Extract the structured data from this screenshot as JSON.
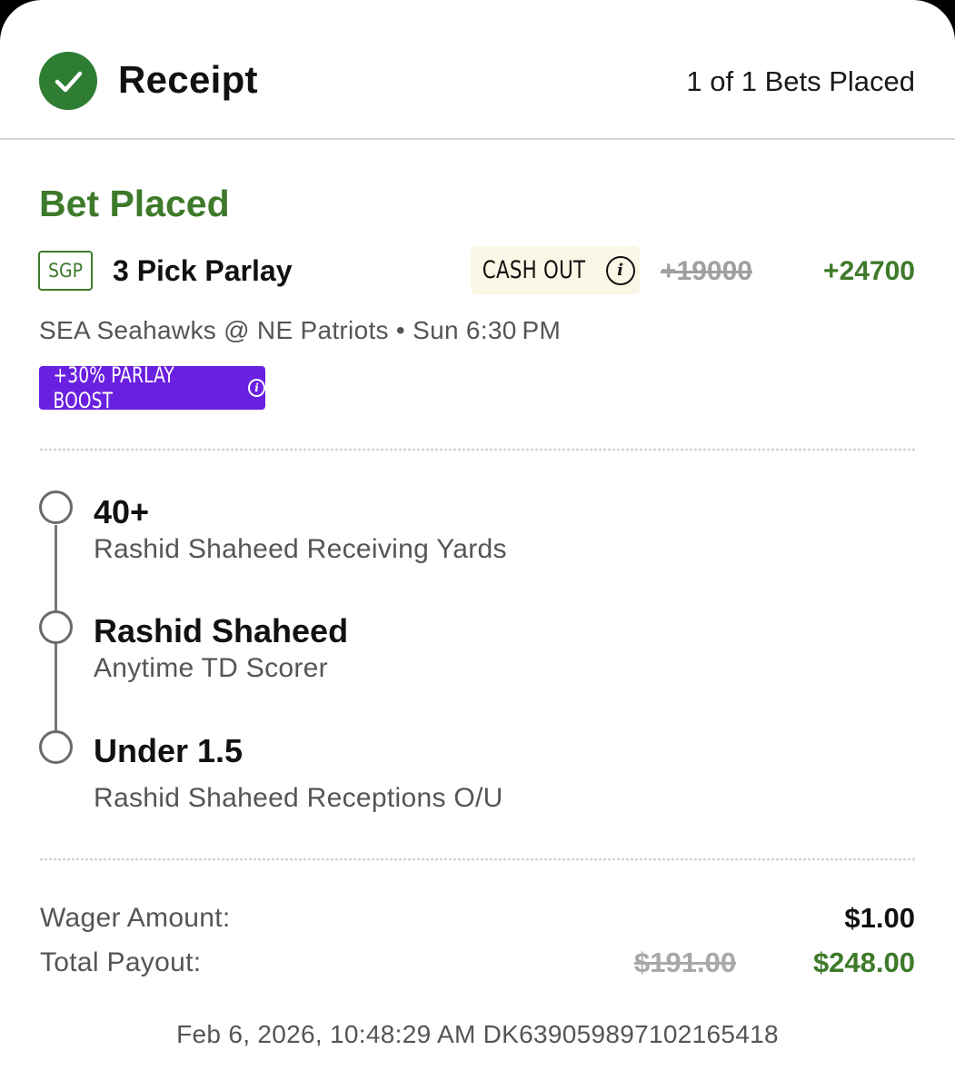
{
  "header": {
    "title": "Receipt",
    "bets_placed": "1 of 1 Bets Placed"
  },
  "bet": {
    "status": "Bet Placed",
    "type_badge": "SGP",
    "title": "3 Pick Parlay",
    "cash_out_label": "CASH OUT",
    "odds_original": "+19000",
    "odds_boosted": "+24700",
    "matchup": "SEA Seahawks @ NE Patriots • Sun 6:30 PM",
    "boost_label": "+30% PARLAY BOOST"
  },
  "legs": [
    {
      "pick": "40+",
      "market": "Rashid Shaheed Receiving Yards"
    },
    {
      "pick": "Rashid Shaheed",
      "market": "Anytime TD Scorer"
    },
    {
      "pick": "Under 1.5",
      "market": "Rashid Shaheed Receptions O/U"
    }
  ],
  "totals": {
    "wager_label": "Wager Amount:",
    "wager_value": "$1.00",
    "payout_label": "Total Payout:",
    "payout_original": "$191.00",
    "payout_boosted": "$248.00"
  },
  "footer": {
    "timestamp_id": "Feb 6, 2026, 10:48:29 AM DK639059897102165418"
  },
  "colors": {
    "accent_green": "#3d7a2a",
    "check_green": "#2e7d32",
    "boost_purple": "#6a20e0",
    "cashout_bg": "#fbf7e6"
  },
  "icons": {
    "status": "check-circle-icon",
    "info": "info-icon"
  }
}
